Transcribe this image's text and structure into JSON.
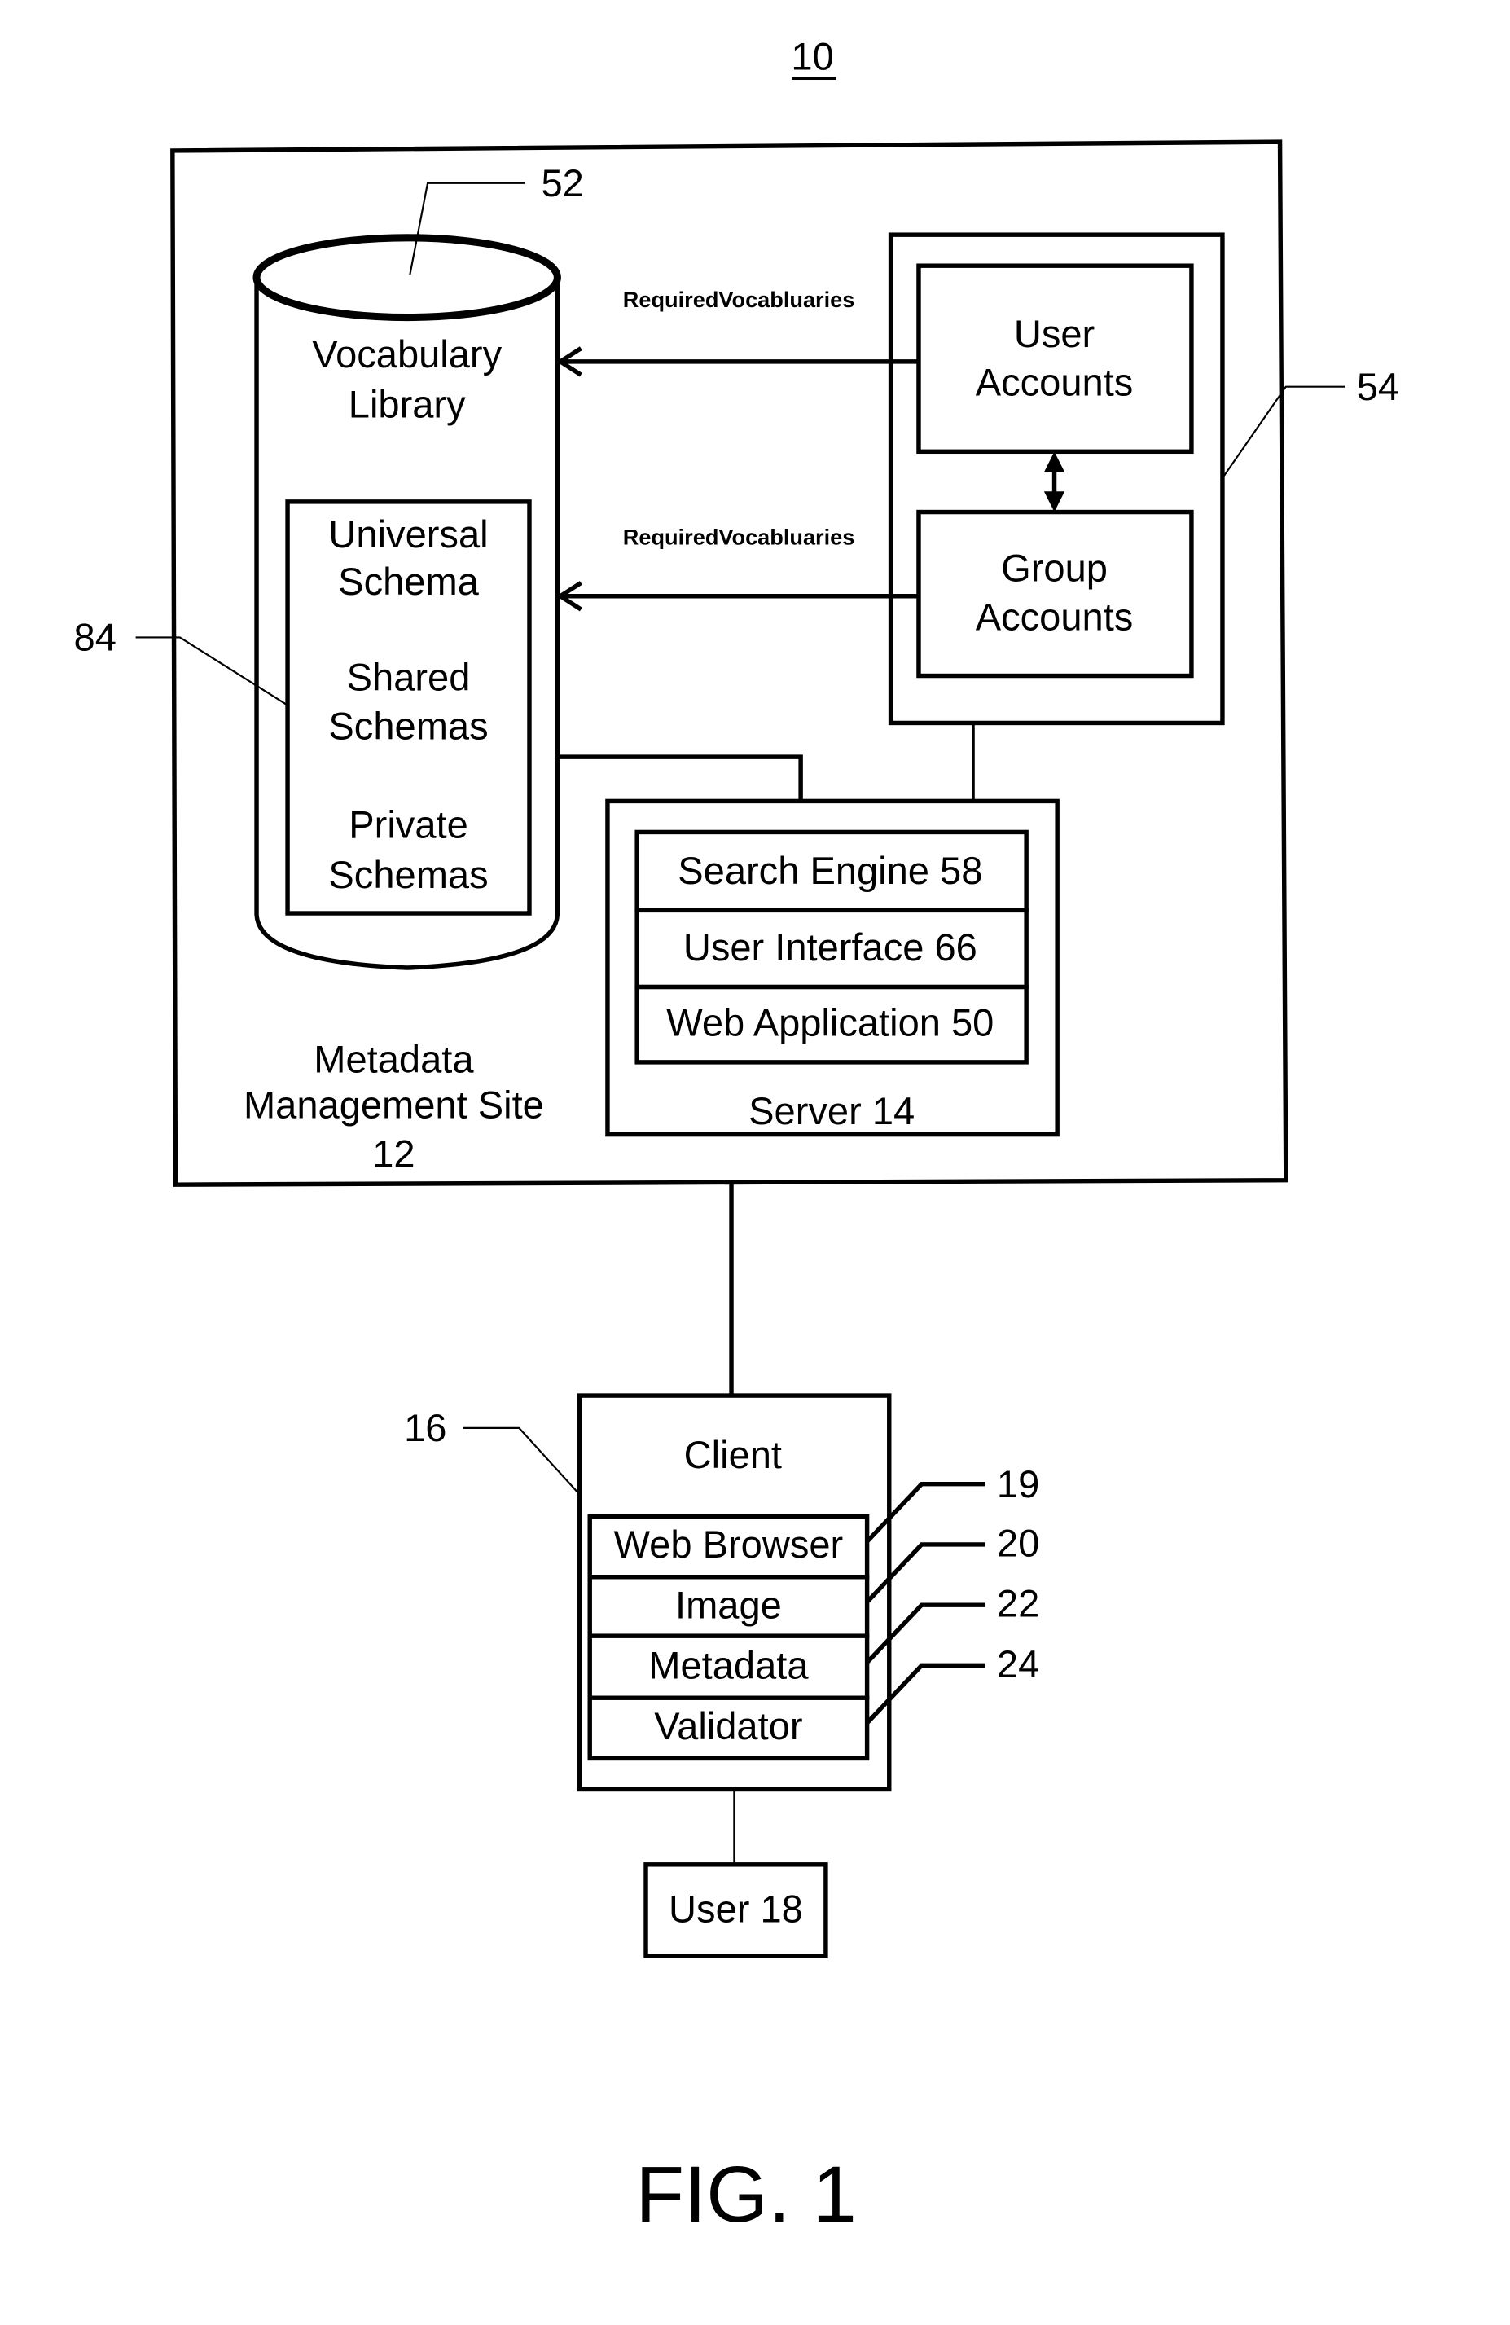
{
  "figure": {
    "number_label": "10",
    "caption": "FIG. 1"
  },
  "site": {
    "title_lines": [
      "Metadata",
      "Management Site",
      "12"
    ]
  },
  "library": {
    "ref": "52",
    "title_lines": [
      "Vocabulary",
      "Library"
    ],
    "schema_ref": "84",
    "schemas": [
      {
        "lines": [
          "Universal",
          "Schema"
        ]
      },
      {
        "lines": [
          "Shared",
          "Schemas"
        ]
      },
      {
        "lines": [
          "Private",
          "Schemas"
        ]
      }
    ]
  },
  "accounts": {
    "ref": "54",
    "user_lines": [
      "User",
      "Accounts"
    ],
    "group_lines": [
      "Group",
      "Accounts"
    ],
    "arrow_label_1": "RequiredVocabluaries",
    "arrow_label_2": "RequiredVocabluaries"
  },
  "server": {
    "label": "Server 14",
    "components": [
      "Search Engine  58",
      "User Interface 66",
      "Web Application 50"
    ]
  },
  "client": {
    "ref": "16",
    "label": "Client",
    "components": [
      {
        "label": "Web Browser",
        "ref": "19"
      },
      {
        "label": "Image",
        "ref": "20"
      },
      {
        "label": "Metadata",
        "ref": "22"
      },
      {
        "label": "Validator",
        "ref": "24"
      }
    ]
  },
  "user": {
    "label": "User 18"
  }
}
